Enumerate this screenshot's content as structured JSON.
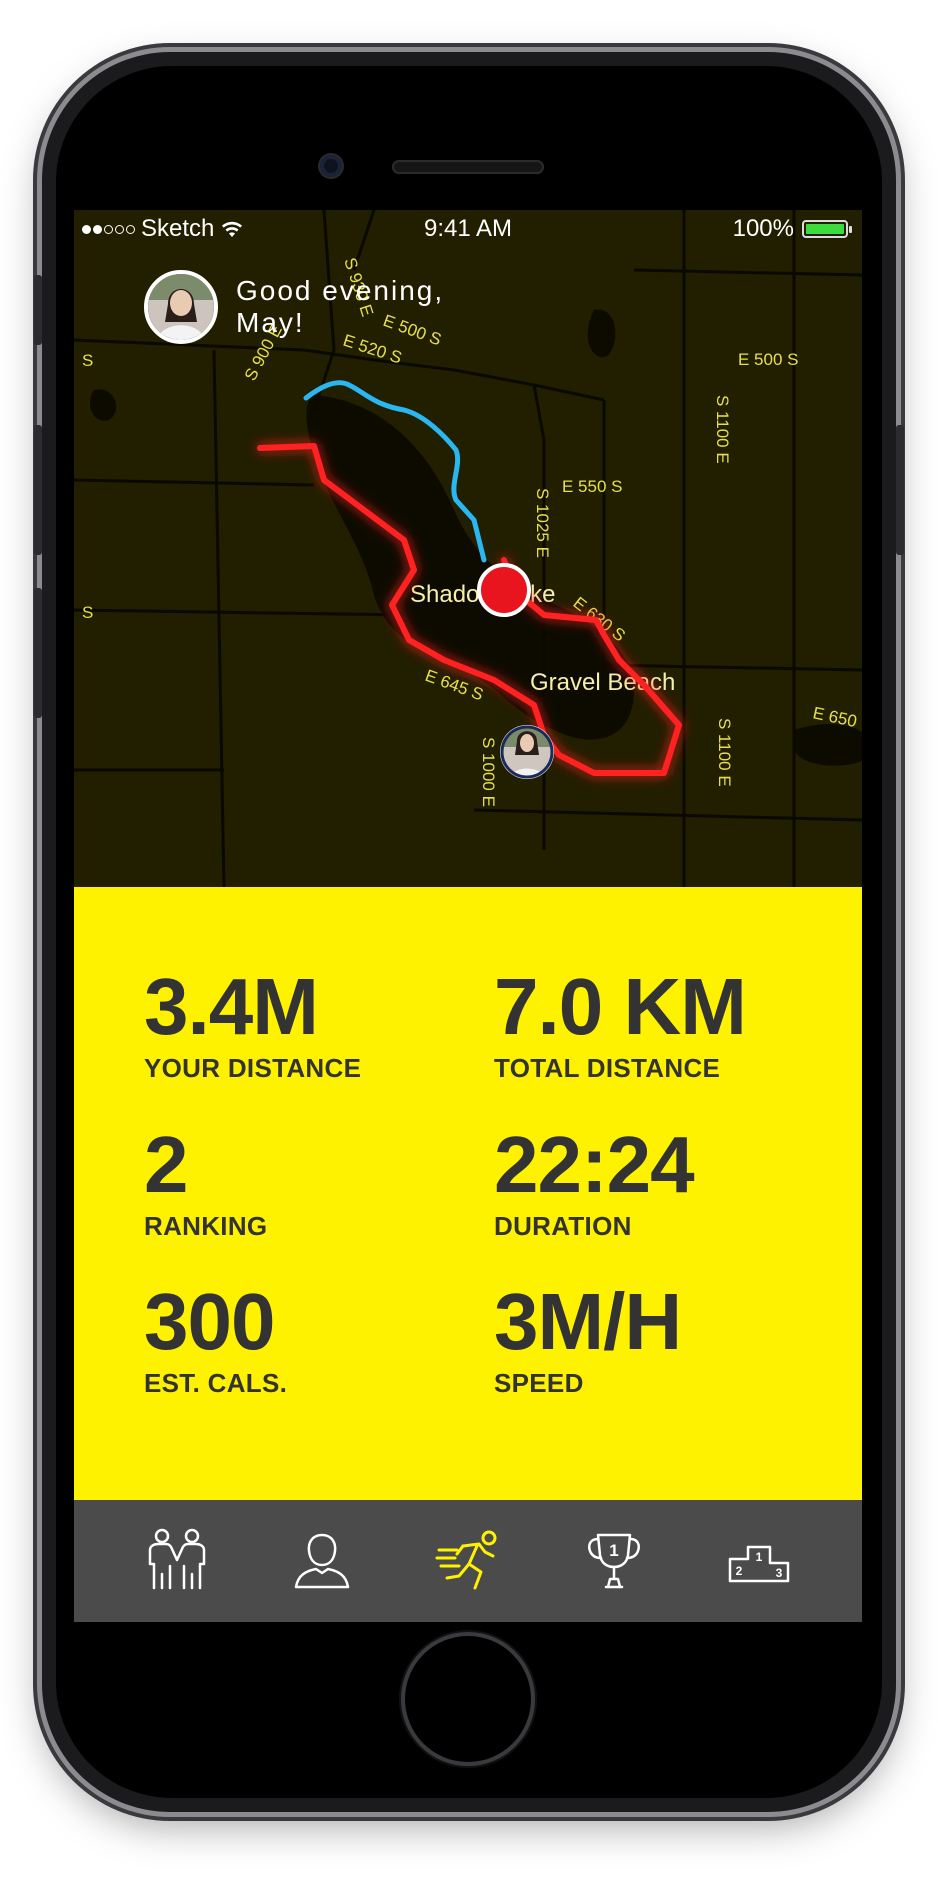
{
  "status_bar": {
    "carrier": "Sketch",
    "time": "9:41 AM",
    "battery": "100%"
  },
  "greeting": {
    "text": "Good evening, May!"
  },
  "map": {
    "place_labels": [
      "Shadow Lake",
      "Gravel Beach"
    ],
    "road_labels": [
      "S 930 E",
      "E 500 S",
      "E 520 S",
      "S 900 E",
      "E 550 S",
      "S 1025 E",
      "E 500 S",
      "S 1100 E",
      "E 630 S",
      "E 645 S",
      "S 1000 E",
      "S 1100 E",
      "E 650",
      "S",
      "S"
    ]
  },
  "stats": [
    {
      "value": "3.4M",
      "label": "YOUR DISTANCE"
    },
    {
      "value": "7.0 KM",
      "label": "TOTAL DISTANCE"
    },
    {
      "value": "2",
      "label": "RANKING"
    },
    {
      "value": "22:24",
      "label": "DURATION"
    },
    {
      "value": "300",
      "label": "EST. CALS."
    },
    {
      "value": "3M/H",
      "label": "SPEED"
    }
  ],
  "tabs": [
    {
      "icon": "friends-icon",
      "active": false
    },
    {
      "icon": "profile-icon",
      "active": false
    },
    {
      "icon": "running-man-icon",
      "active": true
    },
    {
      "icon": "trophy-icon",
      "active": false,
      "badge": "1"
    },
    {
      "icon": "podium-icon",
      "active": false,
      "places": [
        "2",
        "1",
        "3"
      ]
    }
  ],
  "colors": {
    "accent_yellow": "#fff200",
    "route_red": "#ff2020",
    "route_blue": "#2ab6f0",
    "tab_bar": "#4b4b4b",
    "map_bg": "#221e00",
    "text_dark": "#333333"
  }
}
